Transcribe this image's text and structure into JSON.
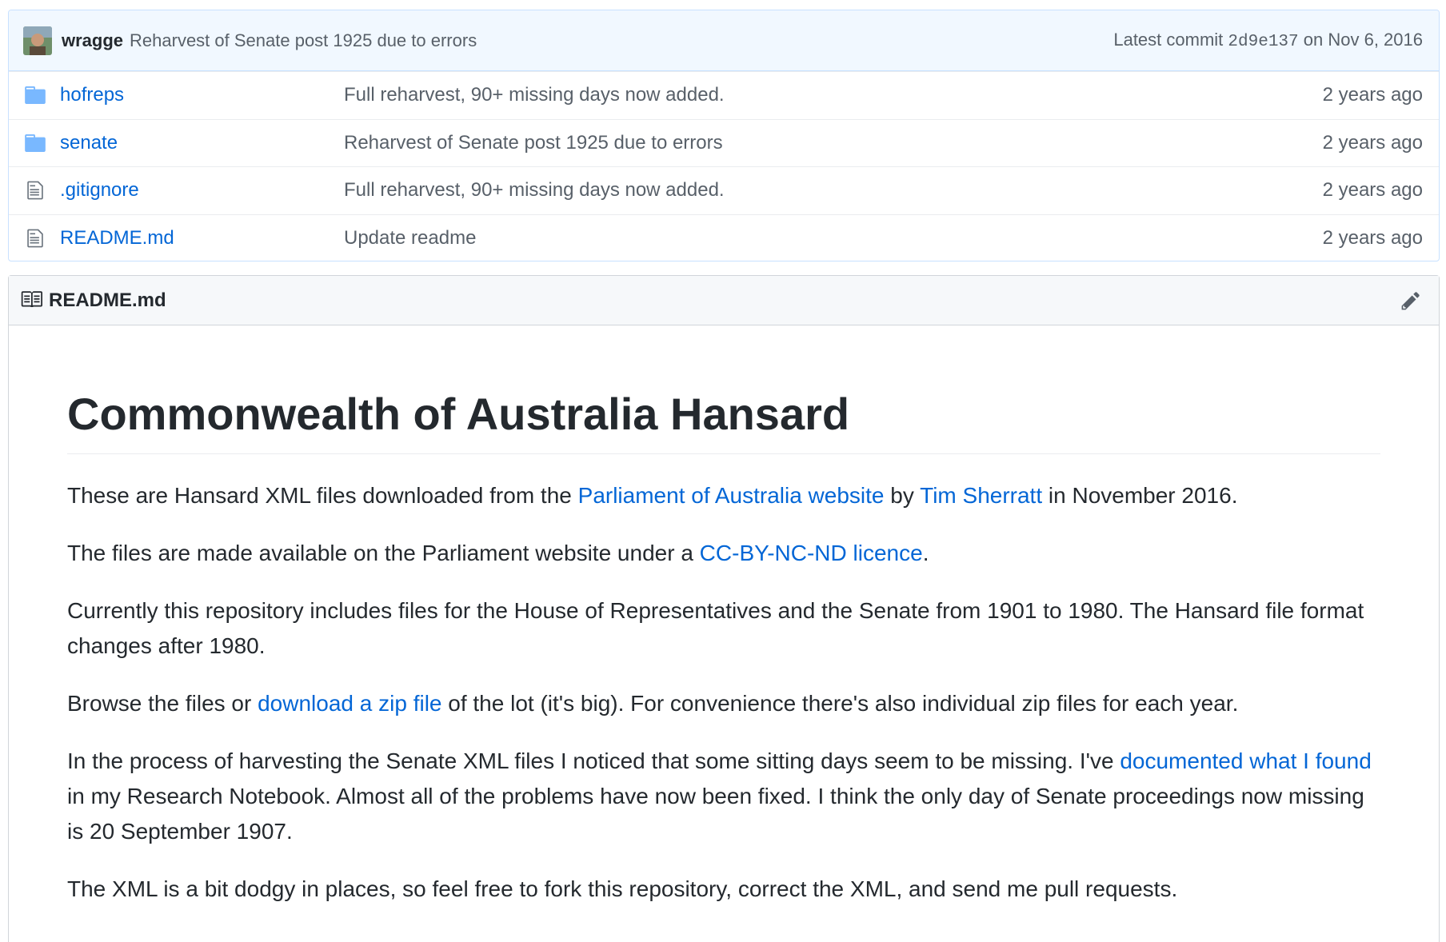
{
  "commit": {
    "author": "wragge",
    "message": "Reharvest of Senate post 1925 due to errors",
    "latest_label": "Latest commit",
    "sha": "2d9e137",
    "date_prefix": "on",
    "date": "Nov 6, 2016"
  },
  "files": [
    {
      "name": "hofreps",
      "type": "folder",
      "message": "Full reharvest, 90+ missing days now added.",
      "age": "2 years ago"
    },
    {
      "name": "senate",
      "type": "folder",
      "message": "Reharvest of Senate post 1925 due to errors",
      "age": "2 years ago"
    },
    {
      "name": ".gitignore",
      "type": "file",
      "message": "Full reharvest, 90+ missing days now added.",
      "age": "2 years ago"
    },
    {
      "name": "README.md",
      "type": "file",
      "message": "Update readme",
      "age": "2 years ago"
    }
  ],
  "readme": {
    "filename": "README.md",
    "heading": "Commonwealth of Australia Hansard",
    "p1": {
      "a": "These are Hansard XML files downloaded from the ",
      "link1": "Parliament of Australia website",
      "b": " by ",
      "link2": "Tim Sherratt",
      "c": " in November 2016."
    },
    "p2": {
      "a": "The files are made available on the Parliament website under a ",
      "link1": "CC-BY-NC-ND licence",
      "b": "."
    },
    "p3": "Currently this repository includes files for the House of Representatives and the Senate from 1901 to 1980. The Hansard file format changes after 1980.",
    "p4": {
      "a": "Browse the files or ",
      "link1": "download a zip file",
      "b": " of the lot (it's big). For convenience there's also individual zip files for each year."
    },
    "p5": {
      "a": "In the process of harvesting the Senate XML files I noticed that some sitting days seem to be missing. I've ",
      "link1": "documented what I found",
      "b": " in my Research Notebook. Almost all of the problems have now been fixed. I think the only day of Senate proceedings now missing is 20 September 1907."
    },
    "p6": "The XML is a bit dodgy in places, so feel free to fork this repository, correct the XML, and send me pull requests."
  }
}
